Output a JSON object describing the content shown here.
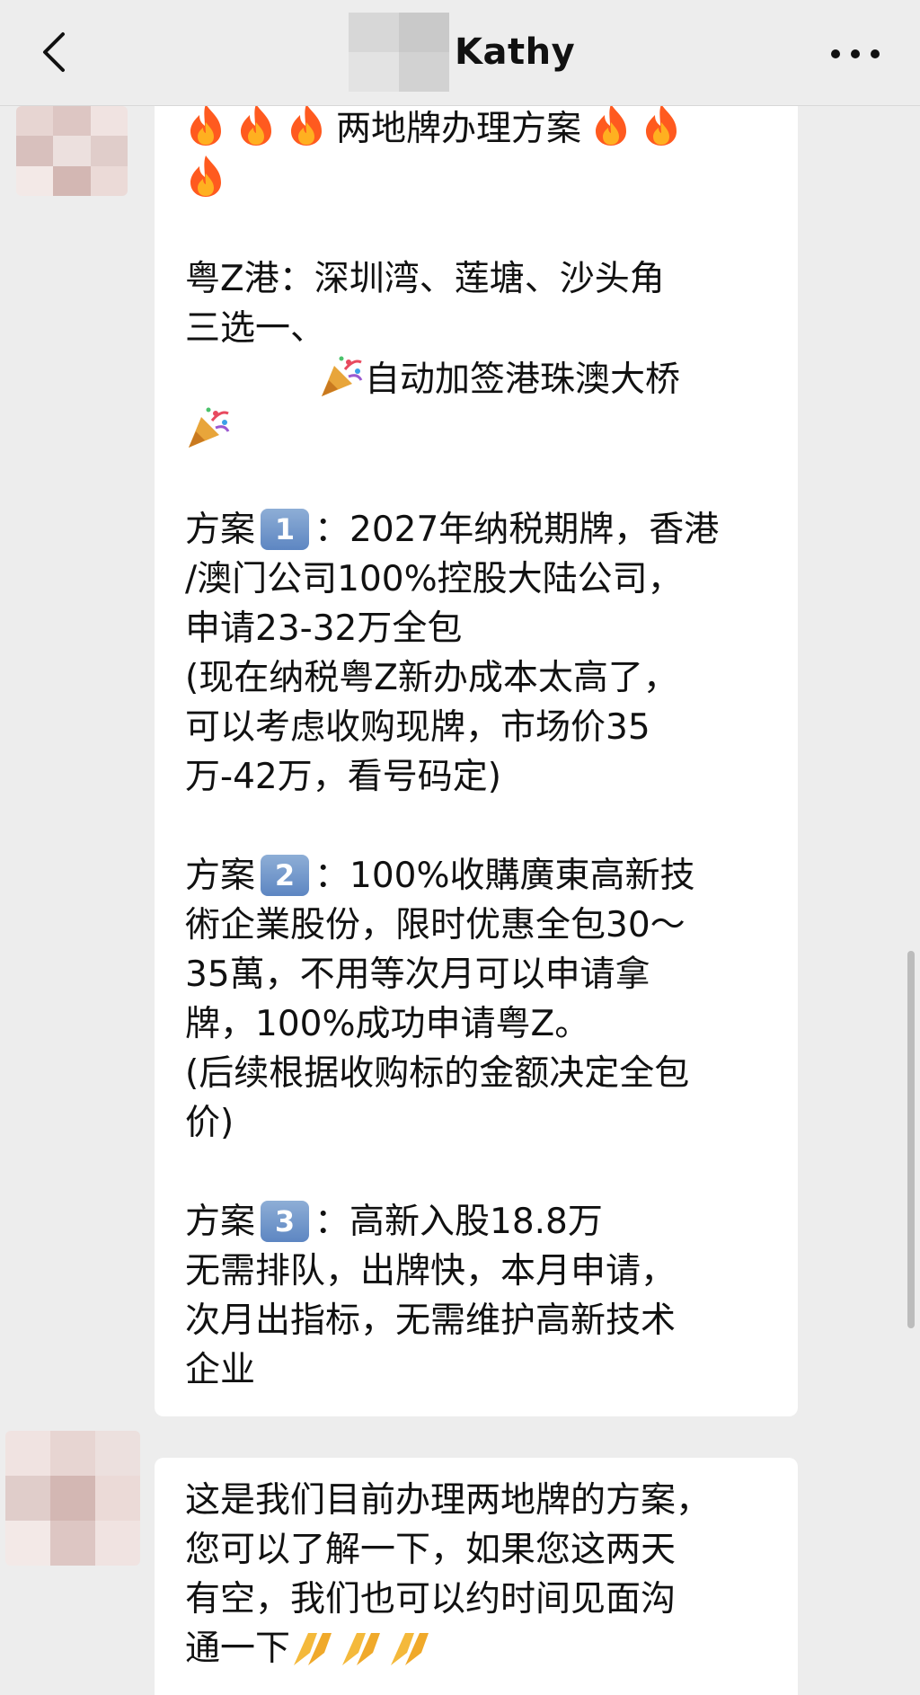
{
  "header": {
    "title": "Kathy",
    "back_icon": "chevron-left-icon",
    "more_icon": "more-icon"
  },
  "message1": {
    "line_title": "两地牌办理方案",
    "line_area_1": "粤Z港：深圳湾、莲塘、沙头角",
    "line_area_2": "三选一、",
    "line_area_3": "自动加签港珠澳大桥",
    "plan1_label": "方案",
    "plan1_key": "1",
    "plan1_line1": "：2027年纳税期牌，香港",
    "plan1_line2": "/澳门公司100%控股大陆公司，",
    "plan1_line3": "申请23-32万全包",
    "plan1_line4": "(现在纳税粤Z新办成本太高了，",
    "plan1_line5": "可以考虑收购现牌，市场价35",
    "plan1_line6": "万-42万，看号码定)",
    "plan2_label": "方案",
    "plan2_key": "2",
    "plan2_line1": "：100%收購廣東高新技",
    "plan2_line2": "術企業股份，限时优惠全包30～",
    "plan2_line3": "35萬，不用等次月可以申请拿",
    "plan2_line4": "牌，100%成功申请粤Z。",
    "plan2_line5": "(后续根据收购标的金额决定全包",
    "plan2_line6": "价)",
    "plan3_label": "方案",
    "plan3_key": "3",
    "plan3_line1": "：高新入股18.8万",
    "plan3_line2": "无需排队，出牌快，本月申请，",
    "plan3_line3": "次月出指标，无需维护高新技术",
    "plan3_line4": "企业"
  },
  "message2": {
    "line1": "这是我们目前办理两地牌的方案，",
    "line2": "您可以了解一下，如果您这两天",
    "line3": "有空，我们也可以约时间见面沟",
    "line4": "通一下"
  },
  "colors": {
    "background": "#ededed",
    "bubble": "#ffffff",
    "keycap": "#6a90c8"
  }
}
